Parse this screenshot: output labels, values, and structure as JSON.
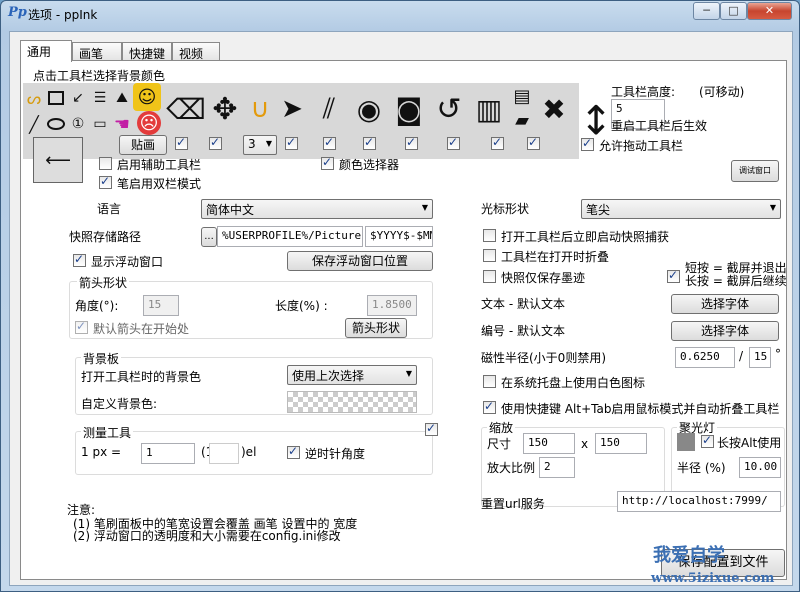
{
  "window": {
    "title": "选项 - ppInk",
    "minimize": "─",
    "maximize": "□",
    "close": "✕"
  },
  "tabs": [
    "通用",
    "画笔",
    "快捷键",
    "视频"
  ],
  "toolbar_section": {
    "caption": "点击工具栏选择背景颜色",
    "snap_label": "贴画",
    "size_value": "3"
  },
  "toolbar_height": {
    "label": "工具栏高度:",
    "movable": "(可移动)",
    "value": "5",
    "restart_note": "重启工具栏后生效"
  },
  "checks": {
    "allow_drag": "允许拖动工具栏",
    "aux_toolbar": "启用辅助工具栏",
    "pen_double_row": "笔启用双栏模式",
    "color_picker": "颜色选择器"
  },
  "mini_button": "调试窗口",
  "language": {
    "label": "语言",
    "value": "简体中文"
  },
  "cursor": {
    "label": "光标形状",
    "value": "笔尖"
  },
  "snapshot": {
    "label": "快照存储路径",
    "browse": "...",
    "path": "%USERPROFILE%/Pictures/",
    "pattern": "$YYYY$-$MM$"
  },
  "float_window": {
    "show": "显示浮动窗口",
    "save_pos": "保存浮动窗口位置"
  },
  "right_checks": {
    "auto_snapshot": "打开工具栏后立即启动快照捕获",
    "fold_on_open": "工具栏在打开时折叠",
    "snapshot_ink_only": "快照仅保存墨迹",
    "shortcut_text": "短按 = 截屏并退出\n长按 = 截屏后继续"
  },
  "arrow": {
    "group": "箭头形状",
    "angle_label": "角度(°):",
    "angle": "15",
    "length_label": "长度(%) :",
    "length": "1.8500",
    "default_start": "默认箭头在开始处",
    "shape_button": "箭头形状"
  },
  "text_font": {
    "label": "文本 - 默认文本",
    "button": "选择字体"
  },
  "number_font": {
    "label": "编号 - 默认文本",
    "button": "选择字体"
  },
  "magnet": {
    "label": "磁性半径(小于0则禁用)",
    "value": "0.6250",
    "sep": "/",
    "angle": "15",
    "unit": "°"
  },
  "background": {
    "group": "背景板",
    "open_label": "打开工具栏时的背景色",
    "open_value": "使用上次选择",
    "custom_label": "自定义背景色:"
  },
  "tray_white": "在系统托盘上使用白色图标",
  "alt_tab": "使用快捷键 Alt+Tab启用鼠标模式并自动折叠工具栏",
  "measure": {
    "group": "测量工具",
    "px_label": "1 px =",
    "value": "1",
    "open": "(1",
    "unit": ")el",
    "ccw": "逆时针角度"
  },
  "zoom": {
    "group": "缩放",
    "size_label": "尺寸",
    "width": "150",
    "x": "x",
    "height": "150",
    "scale_label": "放大比例",
    "scale": "2"
  },
  "spotlight": {
    "group": "聚光灯",
    "long_alt": "长按Alt使用",
    "radius_label": "半径 (%)",
    "radius": "10.00"
  },
  "notes": {
    "title": "注意:",
    "line1": "(1) 笔刷面板中的笔宽设置会覆盖 画笔 设置中的 宽度",
    "line2": "(2) 浮动窗口的透明度和大小需要在config.ini修改"
  },
  "url": {
    "label": "重置url服务",
    "value": "http://localhost:7999/"
  },
  "save_config": "保存配置到文件",
  "watermark": {
    "line1": "我爱自学",
    "line2": "www.5izixue.com"
  }
}
